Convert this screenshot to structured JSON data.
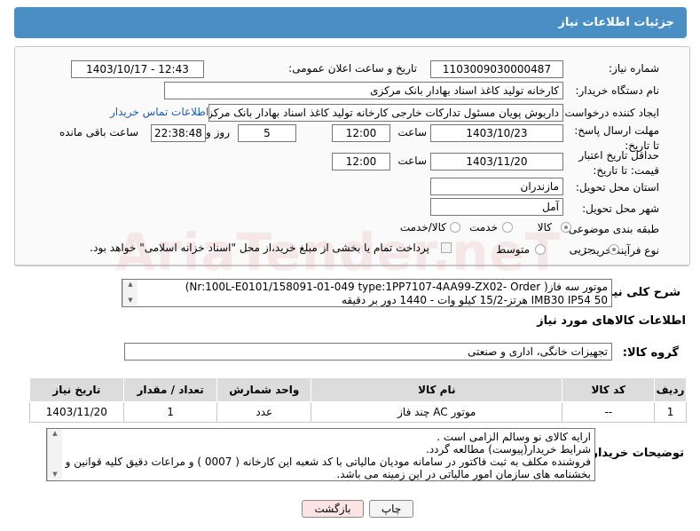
{
  "header": {
    "title": "جزئیات اطلاعات نیاز"
  },
  "form": {
    "need_number_label": "شماره نیاز:",
    "need_number": "1103009030000487",
    "announce_label": "تاریخ و ساعت اعلان عمومی:",
    "announce_value": "1403/10/17 - 12:43",
    "buyer_org_label": "نام دستگاه خریدار:",
    "buyer_org": "کارخانه تولید کاغذ اسناد بهادار بانک مرکزی",
    "requester_label": "ایجاد کننده درخواست:",
    "requester": "داریوش  پویان مسئول تدارکات خارجی کارخانه تولید کاغذ اسناد بهادار بانک مرکزی",
    "buyer_contact_link": "اطلاعات تماس خریدار",
    "deadline_label": "مهلت ارسال پاسخ: تا تاریخ:",
    "deadline_date": "1403/10/23",
    "time_label": "ساعت",
    "deadline_time": "12:00",
    "days_value": "5",
    "days_label": "روز و",
    "remaining_time": "22:38:48",
    "remaining_label": "ساعت باقی مانده",
    "validity_label": "حداقل تاریخ اعتبار قیمت: تا تاریخ:",
    "validity_date": "1403/11/20",
    "validity_time": "12:00",
    "province_label": "استان محل تحویل:",
    "province": "مازندران",
    "city_label": "شهر محل تحویل:",
    "city": "آمل",
    "category_label": "طبقه بندی موضوعی:",
    "category_options": [
      "کالا",
      "خدمت",
      "کالا/خدمت"
    ],
    "process_label": "نوع فرآیند خرید :",
    "process_options": [
      "جزیی",
      "متوسط"
    ],
    "process_note": "پرداخت تمام یا بخشی از مبلغ خرید،از محل \"اسناد خزانه اسلامی\" خواهد بود."
  },
  "description": {
    "label": "شرح کلی نیاز:",
    "line1": "موتور سه فاز(   Nr:100L-E0101/158091-01-049 type:1PP7107-4AA99-ZX02- Order)",
    "line2": "50 IMB30 IP54 هرتز-15/2 کیلو وات - 1440 دور بر دقیقه"
  },
  "goods": {
    "section_title": "اطلاعات کالاهای مورد نیاز",
    "group_label": "گروه کالا:",
    "group_value": "تجهیزات خانگی، اداری و صنعتی",
    "columns": [
      "ردیف",
      "کد کالا",
      "نام کالا",
      "واحد شمارش",
      "تعداد / مقدار",
      "تاریخ نیاز"
    ],
    "rows": [
      {
        "row": "1",
        "code": "--",
        "name": "موتور AC چند فاز",
        "unit": "عدد",
        "qty": "1",
        "date": "1403/11/20"
      }
    ]
  },
  "buyer_notes": {
    "label": "توضیحات خریدار:",
    "line1": "ارایه کالای نو وسالم الزامی است .",
    "line2": "شرایط  خریدار(پیوست) مطالعه گردد.",
    "line3": "فروشنده مکلف به ثبت فاکتور در سامانه مودیان مالیاتی با کد شعبه این کارخانه ( 0007 ) و مراعات دقیق کلیه قوانین و",
    "line4": "بخشنامه های سازمان امور مالیاتی در این زمینه می باشد."
  },
  "buttons": {
    "print": "چاپ",
    "back": "بازگشت"
  },
  "watermark": "AriaTender.neT",
  "colors": {
    "header": "#4a8fc4",
    "link": "#1a5bb8",
    "back_button": "#fde4e4"
  }
}
